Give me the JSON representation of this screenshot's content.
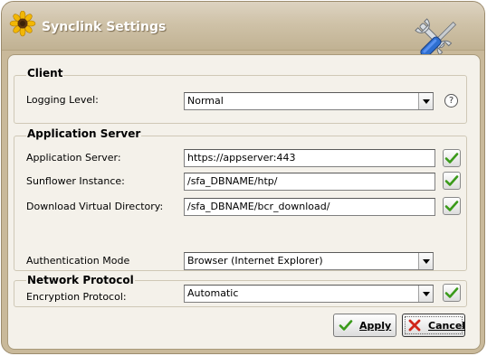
{
  "window": {
    "title": "Synclink Settings"
  },
  "client": {
    "group_title": "Client",
    "logging_level_label": "Logging Level:",
    "logging_level_value": "Normal",
    "help_text": "?"
  },
  "app_server": {
    "group_title": "Application Server",
    "server_label": "Application Server:",
    "server_value": "https://appserver:443",
    "instance_label": "Sunflower Instance:",
    "instance_value": "/sfa_DBNAME/htp/",
    "download_label": "Download Virtual Directory:",
    "download_value": "/sfa_DBNAME/bcr_download/",
    "auth_label": "Authentication Mode",
    "auth_value": "Browser (Internet Explorer)"
  },
  "network": {
    "group_title": "Network Protocol",
    "encryption_label": "Encryption Protocol:",
    "encryption_value": "Automatic"
  },
  "buttons": {
    "apply_label": "Apply",
    "cancel_label": "Cancel"
  },
  "icons": {
    "app": "sunflower-icon",
    "tools": "wrench-screwdriver-icon",
    "check": "green-checkmark-icon",
    "cancel": "red-x-icon",
    "help": "question-mark-icon"
  }
}
